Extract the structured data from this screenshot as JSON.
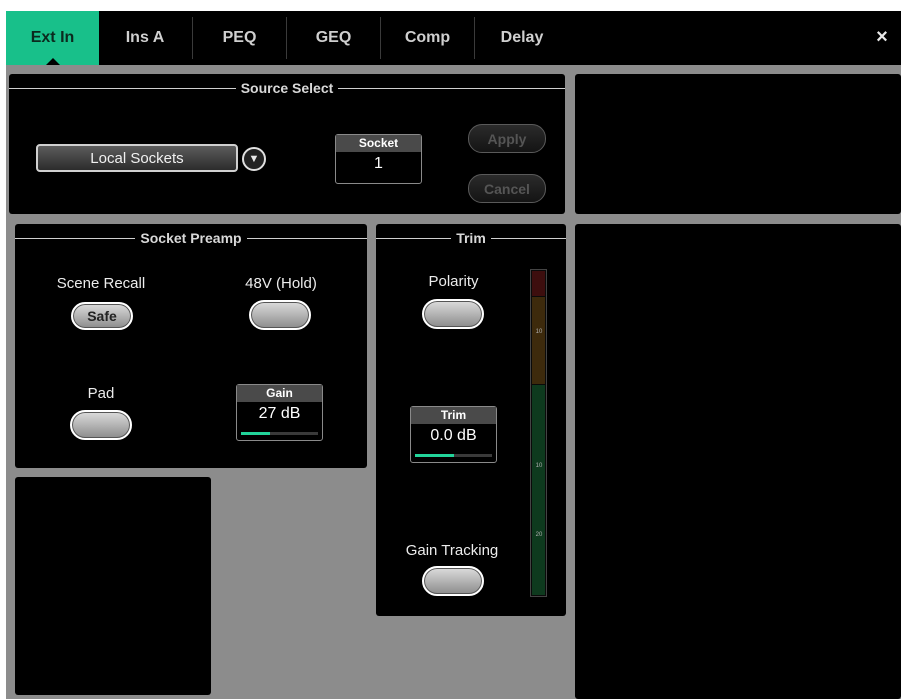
{
  "tabs": [
    {
      "label": "Ext In",
      "active": true
    },
    {
      "label": "Ins A",
      "active": false
    },
    {
      "label": "PEQ",
      "active": false
    },
    {
      "label": "GEQ",
      "active": false
    },
    {
      "label": "Comp",
      "active": false
    },
    {
      "label": "Delay",
      "active": false
    }
  ],
  "close_icon": "×",
  "source_select": {
    "title": "Source Select",
    "dropdown_value": "Local Sockets",
    "dropdown_icon": "▼",
    "socket": {
      "label": "Socket",
      "value": "1"
    },
    "apply_label": "Apply",
    "cancel_label": "Cancel"
  },
  "socket_preamp": {
    "title": "Socket Preamp",
    "scene_recall_label": "Scene Recall",
    "safe_label": "Safe",
    "phantom_label": "48V (Hold)",
    "pad_label": "Pad",
    "gain": {
      "label": "Gain",
      "value": "27 dB",
      "level_fraction": 0.38
    }
  },
  "trim": {
    "title": "Trim",
    "polarity_label": "Polarity",
    "trim_value": {
      "label": "Trim",
      "value": "0.0 dB",
      "level_fraction": 0.5
    },
    "gain_tracking_label": "Gain Tracking",
    "meter_ticks": [
      "10",
      "10",
      "20"
    ]
  },
  "colors": {
    "accent": "#18c08a",
    "background": "#8c8c8c",
    "panel": "#000000",
    "meter_red": "#3d0e0e",
    "meter_amber": "#3d2a0c",
    "meter_green": "#0e3a1e"
  }
}
